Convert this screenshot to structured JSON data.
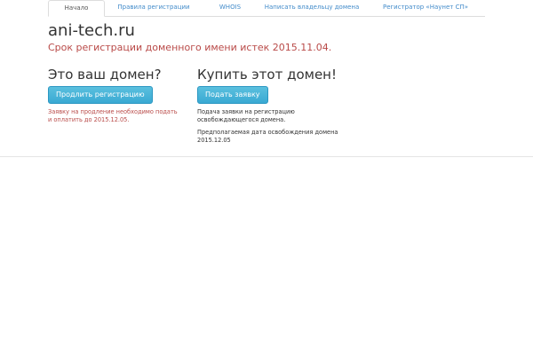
{
  "nav": {
    "tabs": [
      {
        "label": "Начало",
        "active": true
      },
      {
        "label": "Правила регистрации",
        "active": false
      },
      {
        "label": "WHOIS",
        "active": false
      },
      {
        "label": "Написать владельцу домена",
        "active": false
      },
      {
        "label": "Регистратор «Наунет СП»",
        "active": false
      }
    ]
  },
  "domain": {
    "name": "ani-tech.ru",
    "expired_text": "Срок регистрации доменного имени истек 2015.11.04."
  },
  "owner_section": {
    "heading": "Это ваш домен?",
    "button_label": "Продлить регистрацию",
    "note": "Заявку на продление необходимо подать и оплатить до 2015.12.05."
  },
  "buy_section": {
    "heading": "Купить этот домен!",
    "button_label": "Подать заявку",
    "note1": "Подача заявки на регистрацию освобождающегося домена.",
    "note2": "Предполагаемая дата освобождения домена 2015.12.05"
  },
  "colors": {
    "link": "#428bca",
    "alert": "#b94a48",
    "button": "#39a9d3"
  }
}
